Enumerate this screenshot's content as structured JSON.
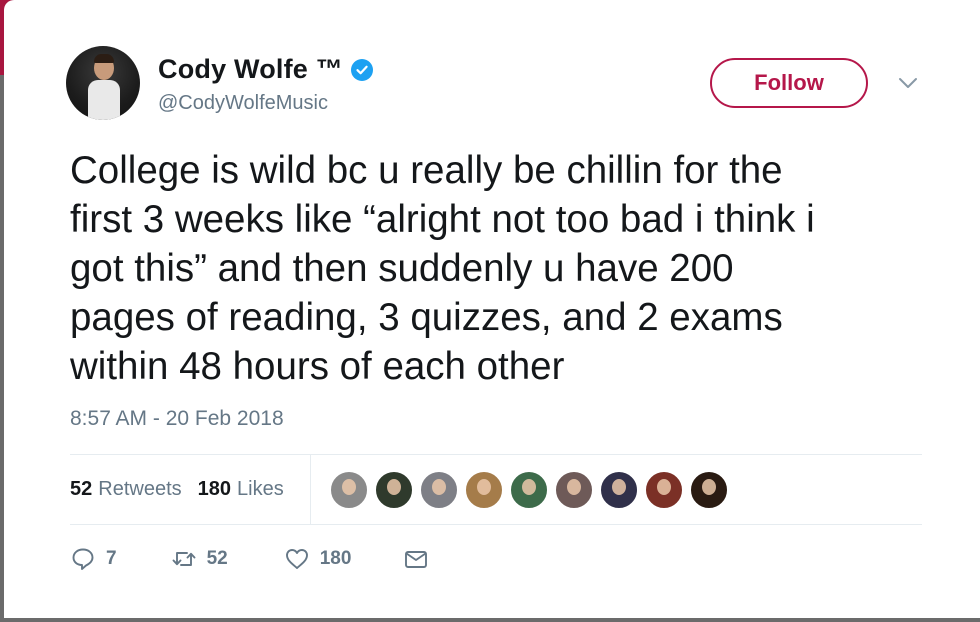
{
  "author": {
    "display_name": "Cody Wolfe ™",
    "handle": "@CodyWolfeMusic",
    "verified": true
  },
  "follow_button": {
    "label": "Follow"
  },
  "tweet": {
    "text": "College is wild bc u really be chillin for the\nfirst 3 weeks like “alright not too bad i think i\ngot this” and then suddenly u have 200\npages of reading, 3 quizzes, and 2 exams\nwithin 48 hours of each other",
    "timestamp": "8:57 AM - 20 Feb 2018"
  },
  "stats": {
    "retweets_count": "52",
    "retweets_label": "Retweets",
    "likes_count": "180",
    "likes_label": "Likes"
  },
  "likers": [
    {
      "color": "#8a8a8a"
    },
    {
      "color": "#2f3a2c"
    },
    {
      "color": "#7e7f86"
    },
    {
      "color": "#a57c4a"
    },
    {
      "color": "#3d6b4a"
    },
    {
      "color": "#6e5a58"
    },
    {
      "color": "#30304a"
    },
    {
      "color": "#7b3026"
    },
    {
      "color": "#2a1b12"
    }
  ],
  "actions": {
    "reply_count": "7",
    "retweet_count": "52",
    "like_count": "180"
  },
  "colors": {
    "accent": "#b5174a",
    "verified": "#1da1f2",
    "muted": "#657786",
    "text": "#14171a"
  },
  "icons": [
    "verified-badge-icon",
    "chevron-down-icon",
    "reply-icon",
    "retweet-icon",
    "heart-icon",
    "envelope-icon"
  ]
}
